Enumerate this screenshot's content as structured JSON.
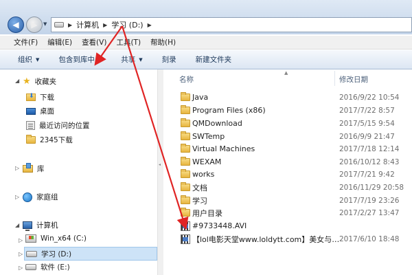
{
  "address": {
    "crumbs": [
      "计算机",
      "学习 (D:)"
    ]
  },
  "menu": [
    "文件(F)",
    "编辑(E)",
    "查看(V)",
    "工具(T)",
    "帮助(H)"
  ],
  "toolbar": {
    "organize": "组织",
    "include_in_library": "包含到库中",
    "share": "共享",
    "burn": "刻录",
    "new_folder": "新建文件夹"
  },
  "nav": {
    "favorites": "收藏夹",
    "downloads": "下载",
    "desktop": "桌面",
    "recent": "最近访问的位置",
    "downloads_2345": "2345下载",
    "libraries": "库",
    "homegroup": "家庭组",
    "computer": "计算机",
    "drive_c": "Win_x64 (C:)",
    "drive_d": "学习 (D:)",
    "drive_e": "软件 (E:)"
  },
  "columns": {
    "name": "名称",
    "modified": "修改日期"
  },
  "files": [
    {
      "name": "Java",
      "date": "2016/9/22 10:54",
      "kind": "folder"
    },
    {
      "name": "Program Files (x86)",
      "date": "2017/7/22 8:57",
      "kind": "folder"
    },
    {
      "name": "QMDownload",
      "date": "2017/5/15 9:54",
      "kind": "folder"
    },
    {
      "name": "SWTemp",
      "date": "2016/9/9 21:47",
      "kind": "folder"
    },
    {
      "name": "Virtual Machines",
      "date": "2017/7/18 12:14",
      "kind": "folder"
    },
    {
      "name": "WEXAM",
      "date": "2016/10/12 8:43",
      "kind": "folder"
    },
    {
      "name": "works",
      "date": "2017/7/21 9:42",
      "kind": "folder"
    },
    {
      "name": "文档",
      "date": "2016/11/29 20:58",
      "kind": "folder"
    },
    {
      "name": "学习",
      "date": "2017/7/19 23:26",
      "kind": "folder"
    },
    {
      "name": "用户目录",
      "date": "2017/2/27 13:47",
      "kind": "folder"
    },
    {
      "name": "#9733448.AVI",
      "date": "",
      "kind": "video"
    },
    {
      "name": "【lol电影天堂www.loldytt.com】美女与…",
      "date": "2017/6/10 18:48",
      "kind": "video"
    }
  ],
  "colors": {
    "annotation_arrow": "#e02424",
    "selection": "#cde3f7"
  }
}
